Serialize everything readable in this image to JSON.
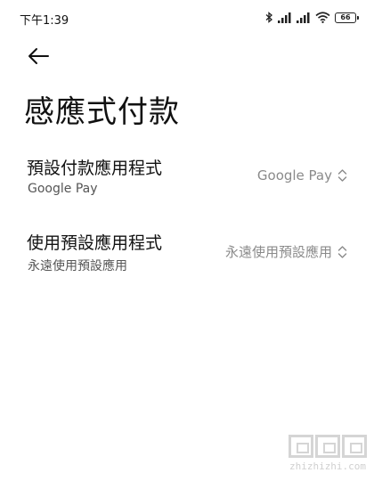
{
  "status_bar": {
    "time": "下午1:39",
    "battery": "66",
    "icons": [
      "bluetooth-icon",
      "signal-icon",
      "signal-icon",
      "wifi-icon",
      "battery-icon"
    ]
  },
  "header": {
    "back_icon": "arrow-left-icon",
    "title": "感應式付款"
  },
  "settings": [
    {
      "title": "預設付款應用程式",
      "subtitle": "Google Pay",
      "value": "Google Pay"
    },
    {
      "title": "使用預設應用程式",
      "subtitle": "永遠使用預設應用",
      "value": "永遠使用預設應用"
    }
  ],
  "watermark": {
    "text": "zhizhizhi.com"
  }
}
